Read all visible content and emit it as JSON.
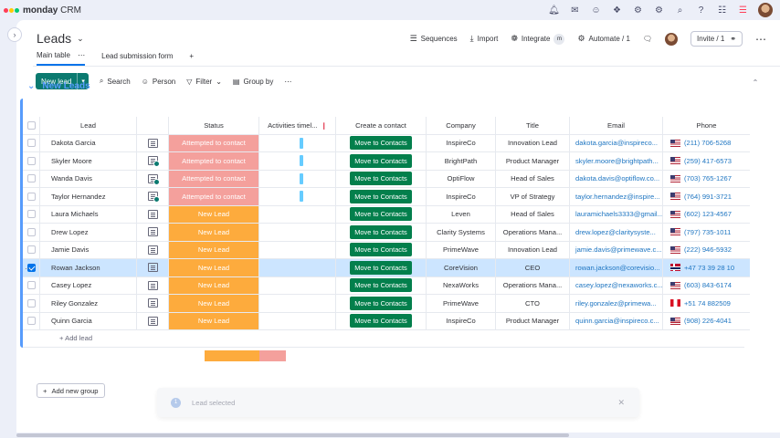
{
  "app": {
    "brand": "monday",
    "product": "CRM",
    "logo_colors": [
      "#ff3d57",
      "#ffcb00",
      "#00ca72"
    ]
  },
  "topbar": {
    "icons": [
      "bell-icon",
      "inbox-icon",
      "invite-members-icon",
      "apps-icon",
      "integrations-icon",
      "settings-icon",
      "search-icon",
      "help-icon",
      "grid-menu-icon",
      "monday-logo-icon",
      "avatar"
    ]
  },
  "board": {
    "title": "Leads",
    "tools": {
      "sequences": "Sequences",
      "import": "Import",
      "integrate": "Integrate",
      "automate": "Automate / 1",
      "invite": "Invite / 1"
    },
    "tabs": [
      {
        "label": "Main table",
        "active": true
      },
      {
        "label": "Lead submission form",
        "active": false
      }
    ],
    "toolbar": {
      "new_lead": "New lead",
      "search": "Search",
      "person": "Person",
      "filter": "Filter",
      "group_by": "Group by"
    },
    "group": {
      "title": "New Leads",
      "color": "#579bfc",
      "add_item": "+ Add lead"
    },
    "columns": {
      "lead": "Lead",
      "status": "Status",
      "activities": "Activities timel...",
      "create_contact": "Create a contact",
      "company": "Company",
      "title": "Title",
      "email": "Email",
      "phone": "Phone"
    },
    "rows": [
      {
        "name": "Dakota Garcia",
        "status": "Attempted to contact",
        "status_type": "attempt",
        "activity": true,
        "conv_badge": false,
        "action": "Move to Contacts",
        "company": "InspireCo",
        "title": "Innovation Lead",
        "email": "dakota.garcia@inspireco...",
        "phone": "(211) 706-5268",
        "flag": "us",
        "selected": false
      },
      {
        "name": "Skyler Moore",
        "status": "Attempted to contact",
        "status_type": "attempt",
        "activity": true,
        "conv_badge": true,
        "action": "Move to Contacts",
        "company": "BrightPath",
        "title": "Product Manager",
        "email": "skyler.moore@brightpath...",
        "phone": "(259) 417-6573",
        "flag": "us",
        "selected": false
      },
      {
        "name": "Wanda Davis",
        "status": "Attempted to contact",
        "status_type": "attempt",
        "activity": true,
        "conv_badge": true,
        "action": "Move to Contacts",
        "company": "OptiFlow",
        "title": "Head of Sales",
        "email": "dakota.davis@optiflow.co...",
        "phone": "(703) 765-1267",
        "flag": "us",
        "selected": false
      },
      {
        "name": "Taylor Hernandez",
        "status": "Attempted to contact",
        "status_type": "attempt",
        "activity": true,
        "conv_badge": true,
        "action": "Move to Contacts",
        "company": "InspireCo",
        "title": "VP of Strategy",
        "email": "taylor.hernandez@inspire...",
        "phone": "(764) 991-3721",
        "flag": "us",
        "selected": false
      },
      {
        "name": "Laura Michaels",
        "status": "New Lead",
        "status_type": "new",
        "activity": false,
        "conv_badge": false,
        "action": "Move to Contacts",
        "company": "Leven",
        "title": "Head of Sales",
        "email": "lauramichaels3333@gmail...",
        "phone": "(602) 123-4567",
        "flag": "us",
        "selected": false
      },
      {
        "name": "Drew Lopez",
        "status": "New Lead",
        "status_type": "new",
        "activity": false,
        "conv_badge": false,
        "action": "Move to Contacts",
        "company": "Clarity Systems",
        "title": "Operations Mana...",
        "email": "drew.lopez@claritysyste...",
        "phone": "(797) 735-1011",
        "flag": "us",
        "selected": false
      },
      {
        "name": "Jamie Davis",
        "status": "New Lead",
        "status_type": "new",
        "activity": false,
        "conv_badge": false,
        "action": "Move to Contacts",
        "company": "PrimeWave",
        "title": "Innovation Lead",
        "email": "jamie.davis@primewave.c...",
        "phone": "(222) 946-5932",
        "flag": "us",
        "selected": false
      },
      {
        "name": "Rowan Jackson",
        "status": "New Lead",
        "status_type": "new",
        "activity": false,
        "conv_badge": false,
        "action": "Move to Contacts",
        "company": "CoreVision",
        "title": "CEO",
        "email": "rowan.jackson@corevisio...",
        "phone": "+47 73 39 28 10",
        "flag": "no",
        "selected": true
      },
      {
        "name": "Casey Lopez",
        "status": "New Lead",
        "status_type": "new",
        "activity": false,
        "conv_badge": false,
        "action": "Move to Contacts",
        "company": "NexaWorks",
        "title": "Operations Mana...",
        "email": "casey.lopez@nexaworks.c...",
        "phone": "(603) 843-6174",
        "flag": "us",
        "selected": false
      },
      {
        "name": "Riley Gonzalez",
        "status": "New Lead",
        "status_type": "new",
        "activity": false,
        "conv_badge": false,
        "action": "Move to Contacts",
        "company": "PrimeWave",
        "title": "CTO",
        "email": "riley.gonzalez@primewa...",
        "phone": "+51 74 882509",
        "flag": "pe",
        "selected": false
      },
      {
        "name": "Quinn Garcia",
        "status": "New Lead",
        "status_type": "new",
        "activity": false,
        "conv_badge": false,
        "action": "Move to Contacts",
        "company": "InspireCo",
        "title": "Product Manager",
        "email": "quinn.garcia@inspireco.c...",
        "phone": "(908) 226-4041",
        "flag": "us",
        "selected": false
      }
    ],
    "status_summary": {
      "new_fraction": 0.67,
      "attempt_fraction": 0.33
    },
    "add_group": "Add new group"
  },
  "toast": {
    "count": "1",
    "label": "Lead selected"
  },
  "colors": {
    "attempt": "#f4a09c",
    "new": "#fdab3d",
    "action": "#037f4c",
    "primary_button": "#0b7a70",
    "link": "#1f76c2"
  }
}
